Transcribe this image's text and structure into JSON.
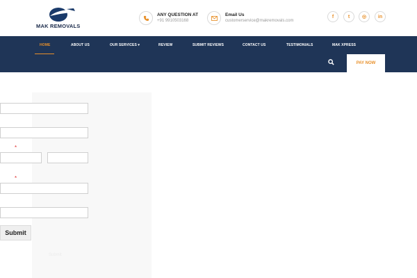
{
  "brand": {
    "name": "MAK REMOVALS",
    "logo_icon": "plane-logo-icon"
  },
  "contacts": [
    {
      "icon": "phone-icon",
      "title": "ANY QUESTION AT",
      "value": "+91 9910503168"
    },
    {
      "icon": "mail-icon",
      "title": "Email Us",
      "value": "customerservice@makremovals.com"
    }
  ],
  "social": [
    {
      "icon": "facebook-icon",
      "glyph": "f"
    },
    {
      "icon": "twitter-icon",
      "glyph": "t"
    },
    {
      "icon": "instagram-icon",
      "glyph": "◎"
    },
    {
      "icon": "linkedin-icon",
      "glyph": "in"
    }
  ],
  "nav": {
    "items": [
      "HOME",
      "ABOUT US",
      "OUR SERVICES ▾",
      "REVIEW",
      "SUBMIT REVIEWS",
      "CONTACT US",
      "TESTIMONIALS",
      "MAK XPRESS"
    ],
    "active": "HOME",
    "search_icon": "search-icon",
    "pay_label": "PAY NOW"
  },
  "form": {
    "required_mark": "*",
    "submit_label": "Submit",
    "faint_text": "Submit"
  },
  "colors": {
    "navy": "#1f3557",
    "accent": "#e8902a",
    "required": "#e03030"
  }
}
